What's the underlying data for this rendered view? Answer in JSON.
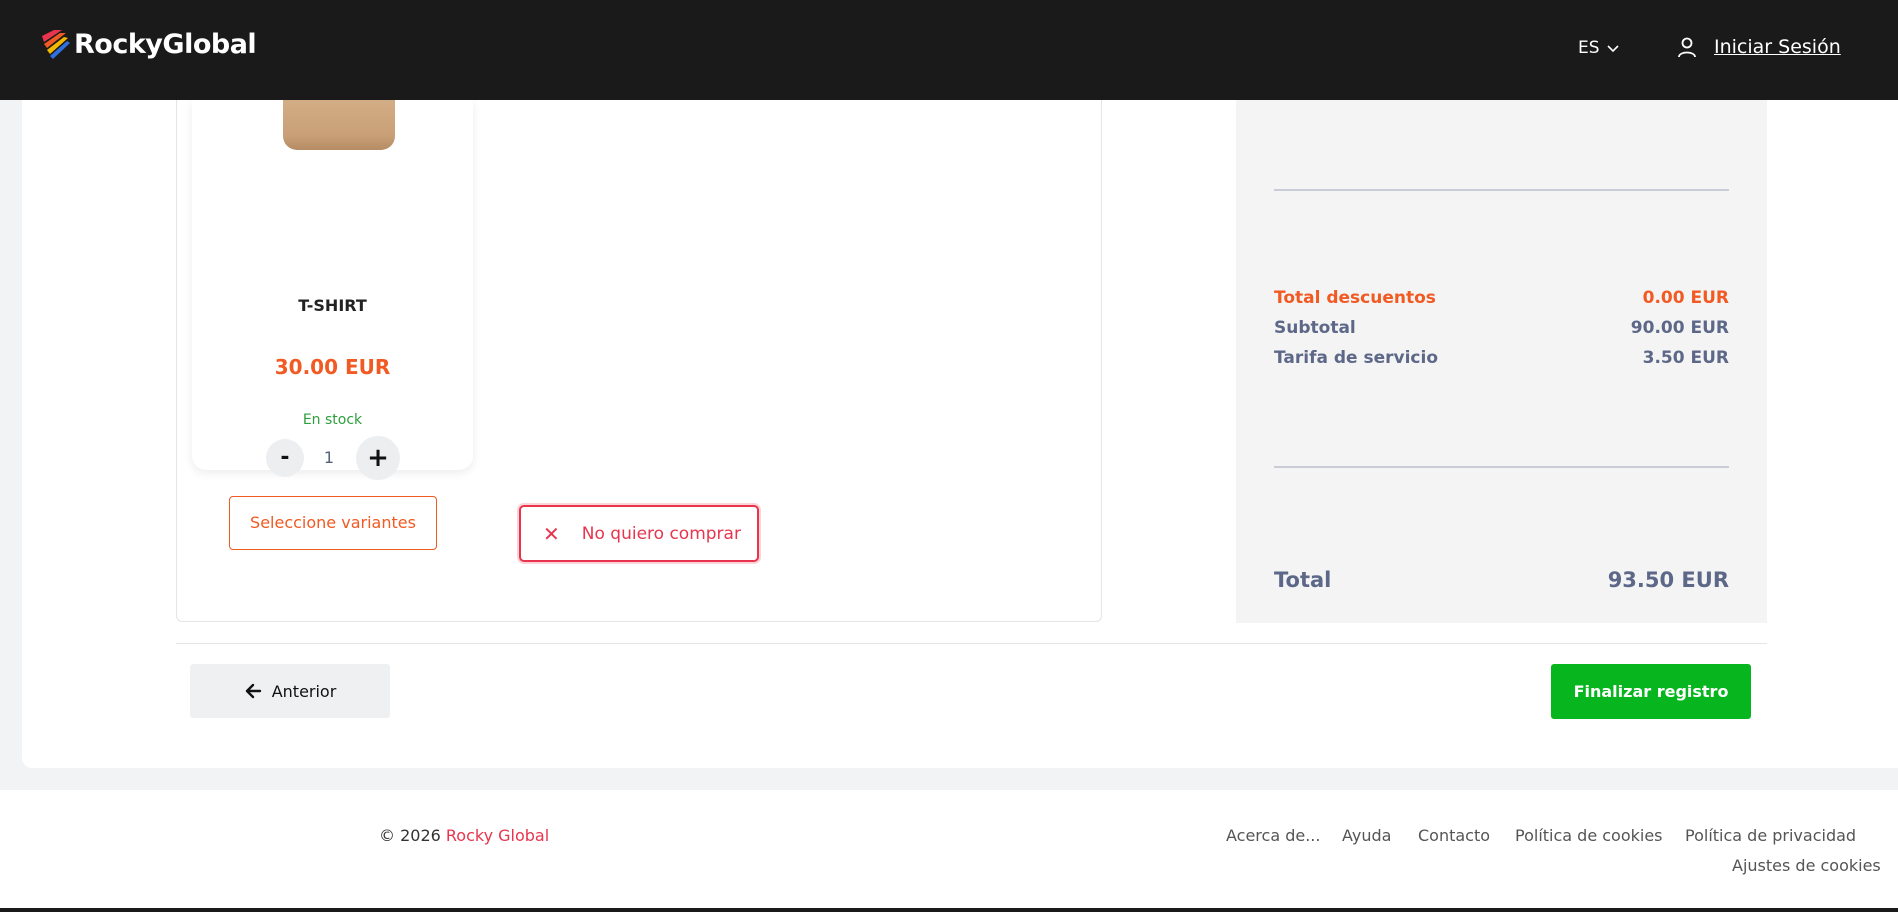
{
  "header": {
    "logo_text": "RockyGlobal",
    "language": "ES",
    "login_label": "Iniciar Sesión"
  },
  "product": {
    "name": "T-SHIRT",
    "price": "30.00 EUR",
    "stock": "En stock",
    "qty_minus": "-",
    "qty_value": "1",
    "qty_plus": "+",
    "variants_label": "Seleccione variantes"
  },
  "no_buy_label": "No quiero comprar",
  "summary": {
    "discount_label": "Total descuentos",
    "discount_value": "0.00 EUR",
    "subtotal_label": "Subtotal",
    "subtotal_value": "90.00 EUR",
    "fee_label": "Tarifa de servicio",
    "fee_value": "3.50 EUR",
    "total_label": "Total",
    "total_value": "93.50 EUR"
  },
  "nav": {
    "back_label": "Anterior",
    "finish_label": "Finalizar registro"
  },
  "footer": {
    "copyright_prefix": "© 2026 ",
    "copyright_brand": "Rocky Global",
    "links": [
      "Acerca de...",
      "Ayuda",
      "Contacto",
      "Política de cookies",
      "Política de privacidad",
      "Ajustes de cookies"
    ]
  },
  "colors": {
    "accent_orange": "#f15a22",
    "danger_red": "#e8354d",
    "success_green": "#07b61f",
    "header_bg": "#1a1a1a"
  }
}
